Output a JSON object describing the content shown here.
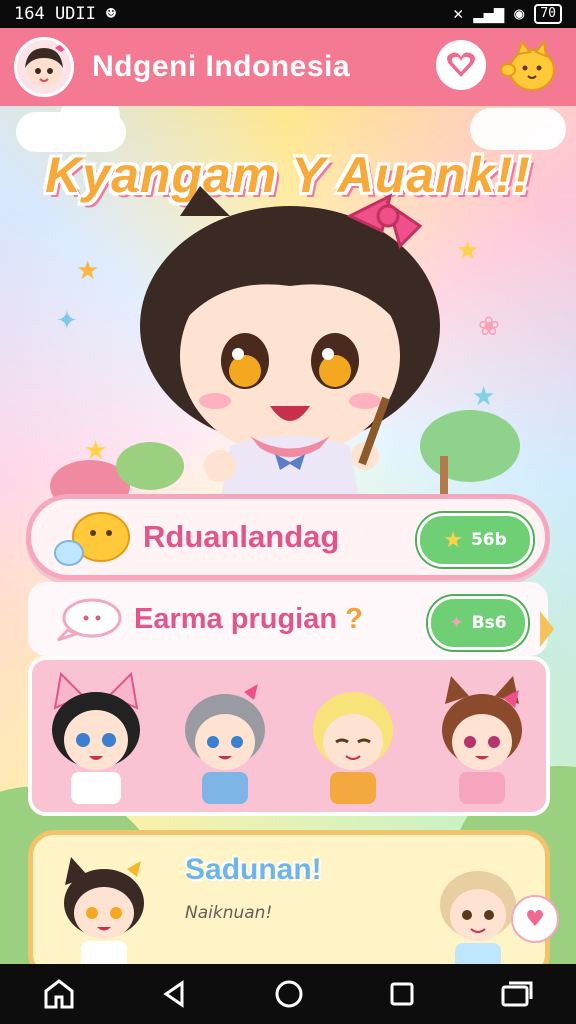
{
  "status_bar": {
    "left_text": "164 UDII",
    "battery": "70"
  },
  "app_bar": {
    "title": "Ndgeni Indonesia"
  },
  "hero": {
    "headline": "Kyangam Y Auank!!"
  },
  "card_primary": {
    "label": "Rduanlandag",
    "button_label": "56b"
  },
  "card_secondary": {
    "label": "Earma prugian",
    "label_suffix": "?",
    "button_label": "Bs6"
  },
  "bottom_card": {
    "title": "Sadunan!",
    "subtitle": "Naiknuan!"
  },
  "colors": {
    "app_bar": "#f47a93",
    "headline": "#f7a93a",
    "label_pink": "#e0558a",
    "pill_green": "#6fcf75",
    "title_blue": "#6fb6e8"
  },
  "icons": [
    "avatar",
    "heart-icon",
    "mascot-icon",
    "star-icon",
    "sparkle-icon",
    "home-icon",
    "back-icon",
    "home-circle-icon",
    "recents-icon",
    "menu-icon"
  ]
}
